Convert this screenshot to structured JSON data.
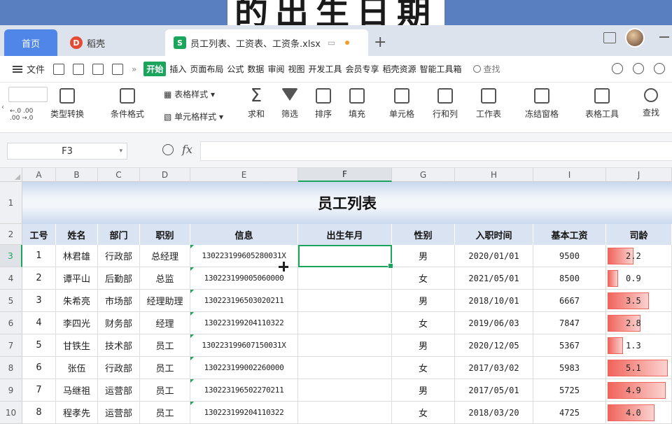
{
  "banner": {
    "text": "的出生日期"
  },
  "tabs": {
    "home": "首页",
    "docer": "稻壳",
    "file": "员工列表、工资表、工资条.xlsx",
    "plus": "+"
  },
  "menu": {
    "file": "文件",
    "more": "»",
    "start": "开始",
    "items": [
      "插入",
      "页面布局",
      "公式",
      "数据",
      "审阅",
      "视图",
      "开发工具",
      "会员专享",
      "稻壳资源",
      "智能工具箱"
    ],
    "search": "查找"
  },
  "ribbon": {
    "type_convert": "类型转换",
    "cond_format": "条件格式",
    "table_style": "表格样式",
    "cell_style": "单元格样式",
    "sum": "求和",
    "filter": "筛选",
    "sort": "排序",
    "fill": "填充",
    "cell": "单元格",
    "row_col": "行和列",
    "sheet": "工作表",
    "freeze": "冻结窗格",
    "table_tools": "表格工具",
    "find": "查找",
    "dec_inc": "←.0 .00",
    "dec_dec": ".00 →.0"
  },
  "formula": {
    "name_box": "F3",
    "fx": "fx",
    "value": ""
  },
  "columns": [
    "A",
    "B",
    "C",
    "D",
    "E",
    "F",
    "G",
    "H",
    "I",
    "J"
  ],
  "rows": [
    "1",
    "2",
    "3",
    "4",
    "5",
    "6",
    "7",
    "8",
    "9",
    "10"
  ],
  "sheet": {
    "title": "员工列表",
    "headers": [
      "工号",
      "姓名",
      "部门",
      "职别",
      "信息",
      "出生年月",
      "性别",
      "入职时间",
      "基本工资",
      "司龄"
    ],
    "data": [
      {
        "id": "1",
        "name": "林君雄",
        "dept": "行政部",
        "title": "总经理",
        "info": "130223199605280031X",
        "birth": "",
        "gender": "男",
        "hire": "2020/01/01",
        "salary": "9500",
        "tenure": "2.2",
        "tenure_frac": 0.43
      },
      {
        "id": "2",
        "name": "谭平山",
        "dept": "后勤部",
        "title": "总监",
        "info": "130223199005060000",
        "birth": "",
        "gender": "女",
        "hire": "2021/05/01",
        "salary": "8500",
        "tenure": "0.9",
        "tenure_frac": 0.18
      },
      {
        "id": "3",
        "name": "朱希亮",
        "dept": "市场部",
        "title": "经理助理",
        "info": "130223196503020211",
        "birth": "",
        "gender": "男",
        "hire": "2018/10/01",
        "salary": "6667",
        "tenure": "3.5",
        "tenure_frac": 0.69
      },
      {
        "id": "4",
        "name": "李四光",
        "dept": "财务部",
        "title": "经理",
        "info": "130223199204110322",
        "birth": "",
        "gender": "女",
        "hire": "2019/06/03",
        "salary": "7847",
        "tenure": "2.8",
        "tenure_frac": 0.55
      },
      {
        "id": "5",
        "name": "甘铁生",
        "dept": "技术部",
        "title": "员工",
        "info": "130223199607150031X",
        "birth": "",
        "gender": "男",
        "hire": "2020/12/05",
        "salary": "5367",
        "tenure": "1.3",
        "tenure_frac": 0.25
      },
      {
        "id": "6",
        "name": "张伍",
        "dept": "行政部",
        "title": "员工",
        "info": "130223199002260000",
        "birth": "",
        "gender": "女",
        "hire": "2017/03/02",
        "salary": "5983",
        "tenure": "5.1",
        "tenure_frac": 1.0
      },
      {
        "id": "7",
        "name": "马继祖",
        "dept": "运营部",
        "title": "员工",
        "info": "130223196502270211",
        "birth": "",
        "gender": "男",
        "hire": "2017/05/01",
        "salary": "5725",
        "tenure": "4.9",
        "tenure_frac": 0.96
      },
      {
        "id": "8",
        "name": "程孝先",
        "dept": "运营部",
        "title": "员工",
        "info": "130223199204110322",
        "birth": "",
        "gender": "女",
        "hire": "2018/03/20",
        "salary": "4725",
        "tenure": "4.0",
        "tenure_frac": 0.78
      }
    ]
  }
}
